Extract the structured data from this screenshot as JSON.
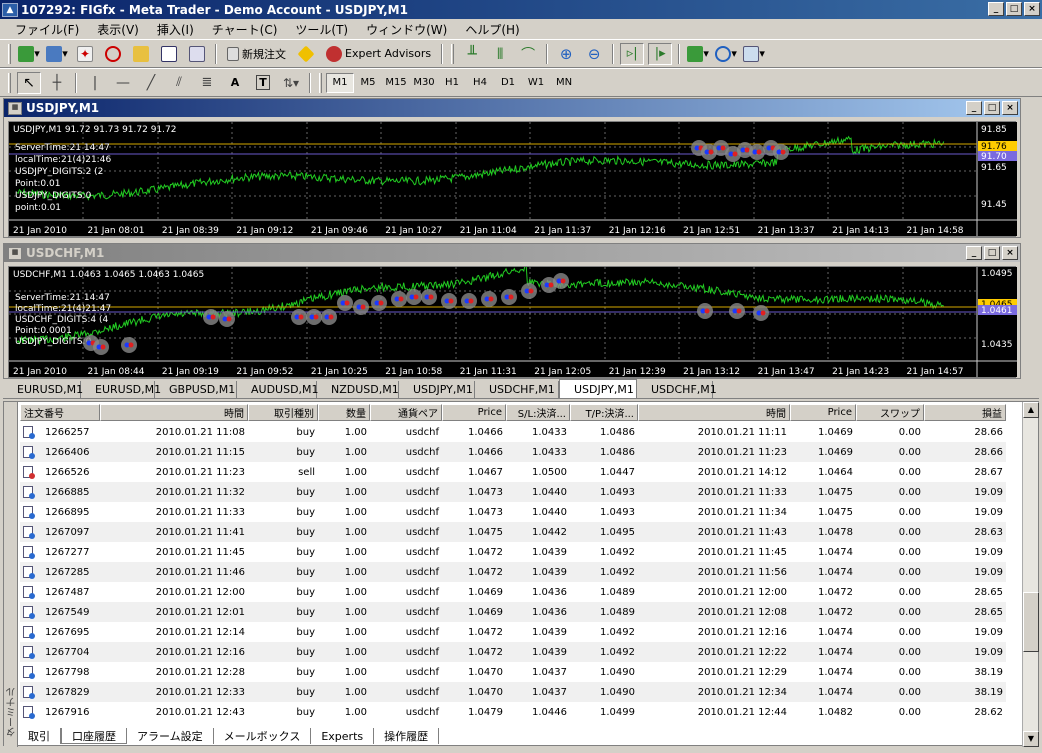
{
  "window": {
    "title": "107292: FIGfx - Meta Trader - Demo Account - USDJPY,M1"
  },
  "menu": [
    "ファイル(F)",
    "表示(V)",
    "挿入(I)",
    "チャート(C)",
    "ツール(T)",
    "ウィンドウ(W)",
    "ヘルプ(H)"
  ],
  "toolbar": {
    "new_order": "新規注文",
    "expert_advisors": "Expert Advisors",
    "text_tool": "A",
    "label_tool": "T"
  },
  "timeframes": [
    "M1",
    "M5",
    "M15",
    "M30",
    "H1",
    "H4",
    "D1",
    "W1",
    "MN"
  ],
  "charts": [
    {
      "title": "USDJPY,M1",
      "ohlc": "USDJPY,M1  91.72 91.73 91.72 91.72",
      "info": [
        "ServerTime:21 14:47",
        "localTime:21(4)21:46",
        "USDJPY_DIGITS:2 (2",
        "Point:0.01",
        "USDJPY_DIGITS:0",
        "point:0.01"
      ],
      "price_labels": [
        "91.85",
        "91.76",
        "91.70",
        "91.65",
        "91.45"
      ],
      "time_labels": [
        "21 Jan 2010",
        "21 Jan 08:01",
        "21 Jan 08:39",
        "21 Jan 09:12",
        "21 Jan 09:46",
        "21 Jan 10:27",
        "21 Jan 11:04",
        "21 Jan 11:37",
        "21 Jan 12:16",
        "21 Jan 12:51",
        "21 Jan 13:37",
        "21 Jan 14:13",
        "21 Jan 14:58"
      ],
      "bid_color": "#ffcc00",
      "ask_color": "#6a5acd"
    },
    {
      "title": "USDCHF,M1",
      "ohlc": "USDCHF,M1  1.0463 1.0465 1.0463 1.0465",
      "info": [
        "ServerTime:21 14:47",
        "localTime:21(4)21:47",
        "USDCHF_DIGITS:4 (4",
        "Point:0.0001",
        "USDJPY_DIGITS:0"
      ],
      "price_labels": [
        "1.0495",
        "1.0465",
        "1.0461",
        "1.0435"
      ],
      "time_labels": [
        "21 Jan 2010",
        "21 Jan 08:44",
        "21 Jan 09:19",
        "21 Jan 09:52",
        "21 Jan 10:25",
        "21 Jan 10:58",
        "21 Jan 11:31",
        "21 Jan 12:05",
        "21 Jan 12:39",
        "21 Jan 13:12",
        "21 Jan 13:47",
        "21 Jan 14:23",
        "21 Jan 14:57"
      ]
    }
  ],
  "chart_tabs": [
    "EURUSD,M1",
    "EURUSD,M1",
    "GBPUSD,M1",
    "AUDUSD,M1",
    "NZDUSD,M1",
    "USDJPY,M1",
    "USDCHF,M1",
    "USDJPY,M1",
    "USDCHF,M1"
  ],
  "active_chart_tab": 7,
  "terminal": {
    "side_label": "ターミナル",
    "columns": [
      "注文番号",
      "時間",
      "取引種別",
      "数量",
      "通貨ペア",
      "Price",
      "S/L:決済...",
      "T/P:決済...",
      "時間",
      "Price",
      "スワップ",
      "損益"
    ],
    "rows": [
      [
        "1266257",
        "2010.01.21 11:08",
        "buy",
        "1.00",
        "usdchf",
        "1.0466",
        "1.0433",
        "1.0486",
        "2010.01.21 11:11",
        "1.0469",
        "0.00",
        "28.66"
      ],
      [
        "1266406",
        "2010.01.21 11:15",
        "buy",
        "1.00",
        "usdchf",
        "1.0466",
        "1.0433",
        "1.0486",
        "2010.01.21 11:23",
        "1.0469",
        "0.00",
        "28.66"
      ],
      [
        "1266526",
        "2010.01.21 11:23",
        "sell",
        "1.00",
        "usdchf",
        "1.0467",
        "1.0500",
        "1.0447",
        "2010.01.21 14:12",
        "1.0464",
        "0.00",
        "28.67"
      ],
      [
        "1266885",
        "2010.01.21 11:32",
        "buy",
        "1.00",
        "usdchf",
        "1.0473",
        "1.0440",
        "1.0493",
        "2010.01.21 11:33",
        "1.0475",
        "0.00",
        "19.09"
      ],
      [
        "1266895",
        "2010.01.21 11:33",
        "buy",
        "1.00",
        "usdchf",
        "1.0473",
        "1.0440",
        "1.0493",
        "2010.01.21 11:34",
        "1.0475",
        "0.00",
        "19.09"
      ],
      [
        "1267097",
        "2010.01.21 11:41",
        "buy",
        "1.00",
        "usdchf",
        "1.0475",
        "1.0442",
        "1.0495",
        "2010.01.21 11:43",
        "1.0478",
        "0.00",
        "28.63"
      ],
      [
        "1267277",
        "2010.01.21 11:45",
        "buy",
        "1.00",
        "usdchf",
        "1.0472",
        "1.0439",
        "1.0492",
        "2010.01.21 11:45",
        "1.0474",
        "0.00",
        "19.09"
      ],
      [
        "1267285",
        "2010.01.21 11:46",
        "buy",
        "1.00",
        "usdchf",
        "1.0472",
        "1.0439",
        "1.0492",
        "2010.01.21 11:56",
        "1.0474",
        "0.00",
        "19.09"
      ],
      [
        "1267487",
        "2010.01.21 12:00",
        "buy",
        "1.00",
        "usdchf",
        "1.0469",
        "1.0436",
        "1.0489",
        "2010.01.21 12:00",
        "1.0472",
        "0.00",
        "28.65"
      ],
      [
        "1267549",
        "2010.01.21 12:01",
        "buy",
        "1.00",
        "usdchf",
        "1.0469",
        "1.0436",
        "1.0489",
        "2010.01.21 12:08",
        "1.0472",
        "0.00",
        "28.65"
      ],
      [
        "1267695",
        "2010.01.21 12:14",
        "buy",
        "1.00",
        "usdchf",
        "1.0472",
        "1.0439",
        "1.0492",
        "2010.01.21 12:16",
        "1.0474",
        "0.00",
        "19.09"
      ],
      [
        "1267704",
        "2010.01.21 12:16",
        "buy",
        "1.00",
        "usdchf",
        "1.0472",
        "1.0439",
        "1.0492",
        "2010.01.21 12:22",
        "1.0474",
        "0.00",
        "19.09"
      ],
      [
        "1267798",
        "2010.01.21 12:28",
        "buy",
        "1.00",
        "usdchf",
        "1.0470",
        "1.0437",
        "1.0490",
        "2010.01.21 12:29",
        "1.0474",
        "0.00",
        "38.19"
      ],
      [
        "1267829",
        "2010.01.21 12:33",
        "buy",
        "1.00",
        "usdchf",
        "1.0470",
        "1.0437",
        "1.0490",
        "2010.01.21 12:34",
        "1.0474",
        "0.00",
        "38.19"
      ],
      [
        "1267916",
        "2010.01.21 12:43",
        "buy",
        "1.00",
        "usdchf",
        "1.0479",
        "1.0446",
        "1.0499",
        "2010.01.21 12:44",
        "1.0482",
        "0.00",
        "28.62"
      ]
    ],
    "tabs": [
      "取引",
      "口座履歴",
      "アラーム設定",
      "メールボックス",
      "Experts",
      "操作履歴"
    ],
    "active_tab": 1
  }
}
